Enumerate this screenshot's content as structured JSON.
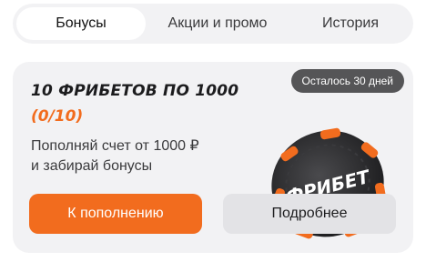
{
  "tabs": [
    {
      "label": "Бонусы",
      "active": true
    },
    {
      "label": "Акции и промо",
      "active": false
    },
    {
      "label": "История",
      "active": false
    }
  ],
  "promo": {
    "badge": "Осталось 30 дней",
    "title": "10 ФРИБЕТОВ ПО 1000",
    "progress": "(0/10)",
    "description_line1": "Пополняй счет от 1000 ₽",
    "description_line2": "и забирай бонусы",
    "chip_text": "ФРИБЕТ",
    "primary_button": "К пополнению",
    "secondary_button": "Подробнее"
  },
  "colors": {
    "accent": "#f26c1e",
    "chip": "#2b2b2d",
    "badge_bg": "#555557",
    "card_bg": "#f2f2f4"
  }
}
